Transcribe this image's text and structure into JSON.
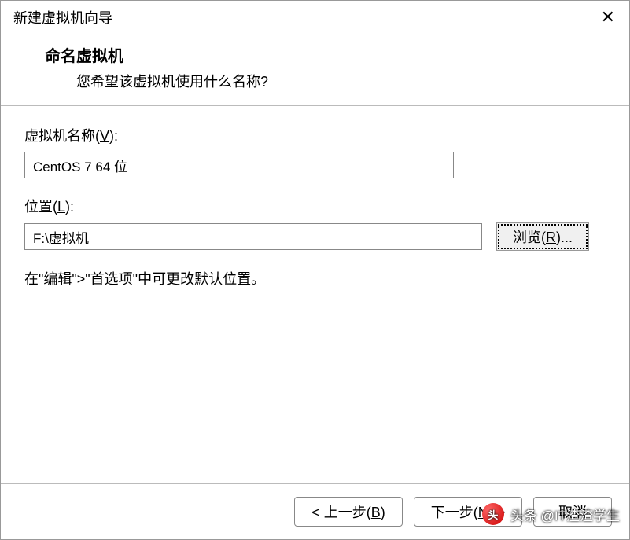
{
  "window": {
    "title": "新建虚拟机向导"
  },
  "header": {
    "title": "命名虚拟机",
    "subtitle": "您希望该虚拟机使用什么名称?"
  },
  "form": {
    "name_label_pre": "虚拟机名称(",
    "name_label_key": "V",
    "name_label_post": "):",
    "name_value": "CentOS 7 64 位",
    "location_label_pre": "位置(",
    "location_label_key": "L",
    "location_label_post": "):",
    "location_value": "F:\\虚拟机",
    "browse_label_pre": "浏览(",
    "browse_label_key": "R",
    "browse_label_post": ")...",
    "hint": "在\"编辑\">\"首选项\"中可更改默认位置。"
  },
  "footer": {
    "back_pre": "< 上一步(",
    "back_key": "B",
    "back_post": ")",
    "next_pre": "下一步(",
    "next_key": "N",
    "next_post": ") >",
    "cancel": "取消"
  },
  "watermark": {
    "icon": "头",
    "text": "头条 @IT渣渣学生"
  }
}
